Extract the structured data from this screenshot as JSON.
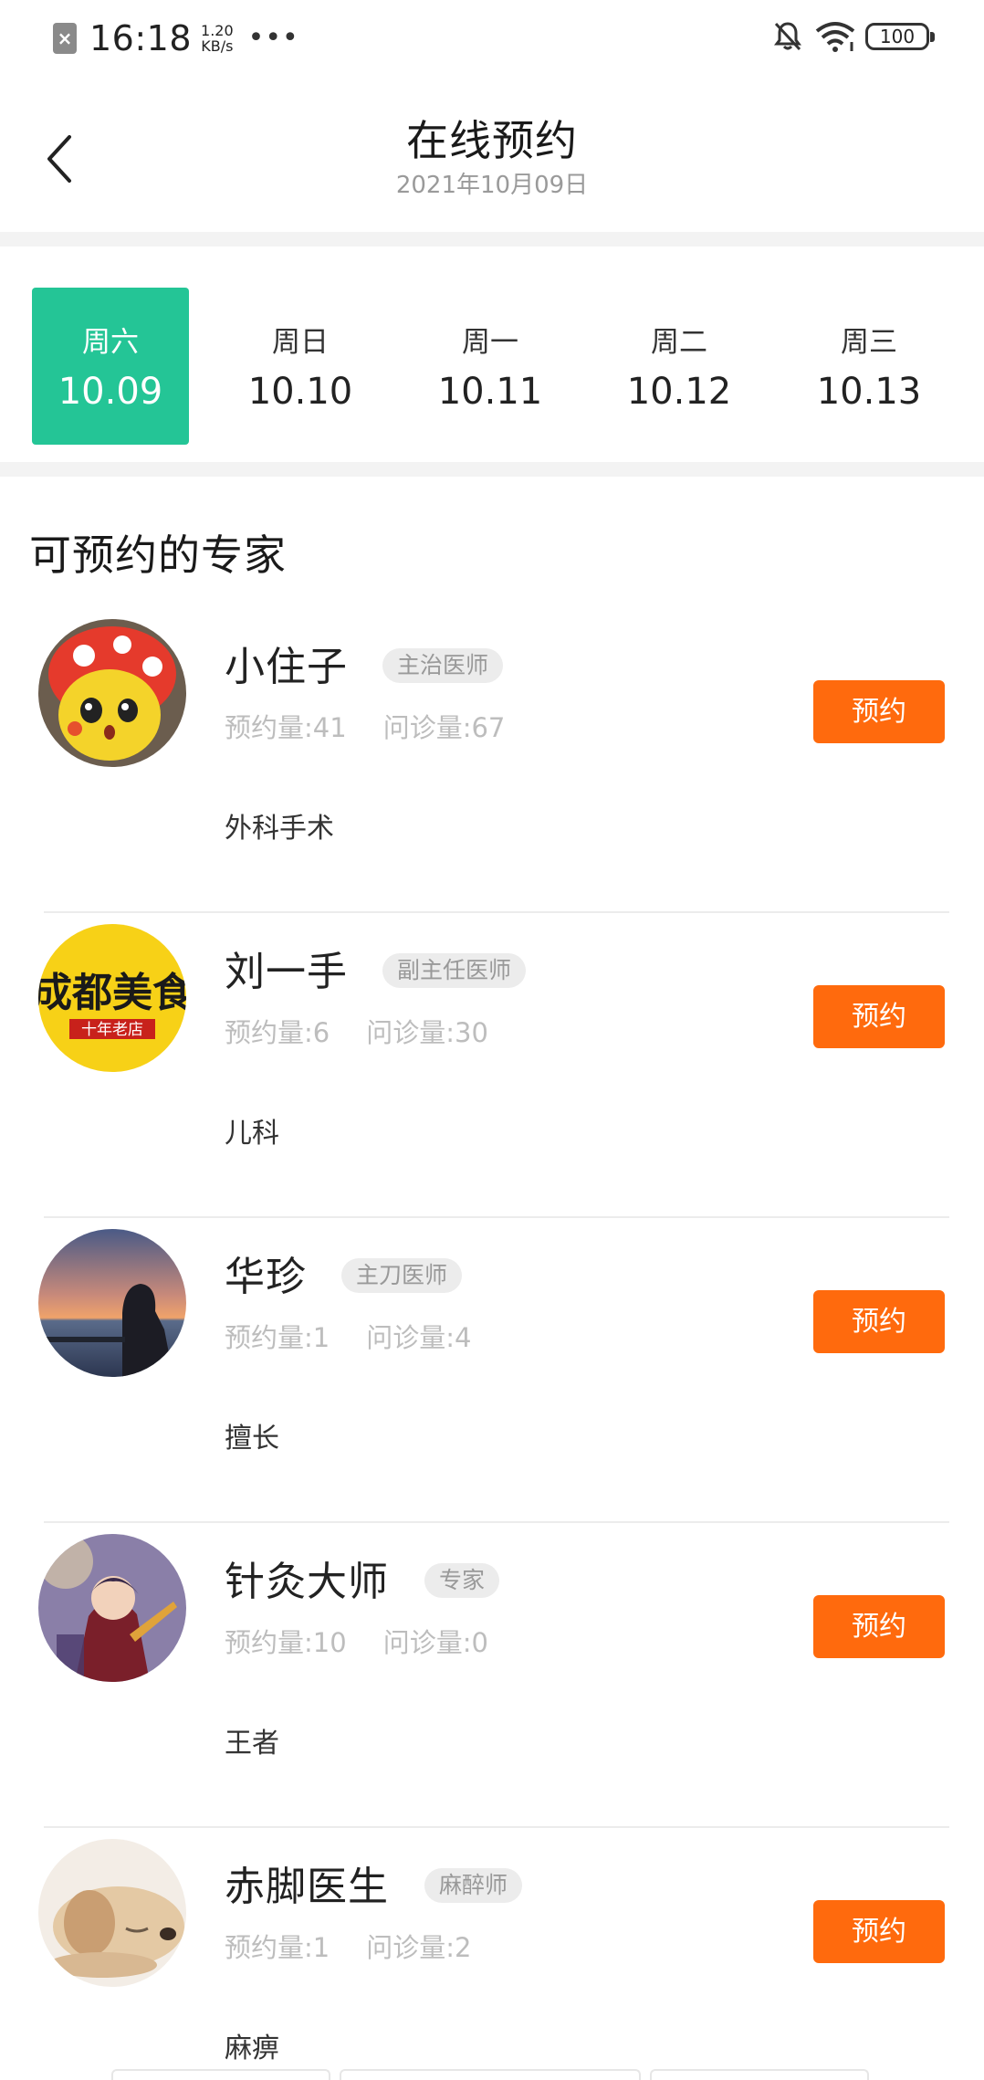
{
  "status_bar": {
    "time": "16:18",
    "net_speed_value": "1.20",
    "net_speed_unit": "KB/s",
    "more": "•••",
    "battery": "100"
  },
  "header": {
    "title": "在线预约",
    "date": "2021年10月09日"
  },
  "dates": [
    {
      "dow": "周六",
      "day": "10.09",
      "active": true
    },
    {
      "dow": "周日",
      "day": "10.10",
      "active": false
    },
    {
      "dow": "周一",
      "day": "10.11",
      "active": false
    },
    {
      "dow": "周二",
      "day": "10.12",
      "active": false
    },
    {
      "dow": "周三",
      "day": "10.13",
      "active": false
    }
  ],
  "section_title": "可预约的专家",
  "doctors": [
    {
      "name": "小住子",
      "title": "主治医师",
      "booked": "预约量:41",
      "consulted": "问诊量:67",
      "specialty": "外科手术",
      "button": "预约"
    },
    {
      "name": "刘一手",
      "title": "副主任医师",
      "booked": "预约量:6",
      "consulted": "问诊量:30",
      "specialty": "儿科",
      "button": "预约"
    },
    {
      "name": "华珍",
      "title": "主刀医师",
      "booked": "预约量:1",
      "consulted": "问诊量:4",
      "specialty": "擅长",
      "button": "预约"
    },
    {
      "name": "针灸大师",
      "title": "专家",
      "booked": "预约量:10",
      "consulted": "问诊量:0",
      "specialty": "王者",
      "button": "预约"
    },
    {
      "name": "赤脚医生",
      "title": "麻醉师",
      "booked": "预约量:1",
      "consulted": "问诊量:2",
      "specialty": "麻痹",
      "button": "预约"
    }
  ],
  "avatar_logo_text": {
    "main": "成都美食",
    "sub": "十年老店"
  },
  "colors": {
    "accent_green": "#24c596",
    "button_orange": "#ff6a0d",
    "muted_text": "#bdbdbd"
  }
}
